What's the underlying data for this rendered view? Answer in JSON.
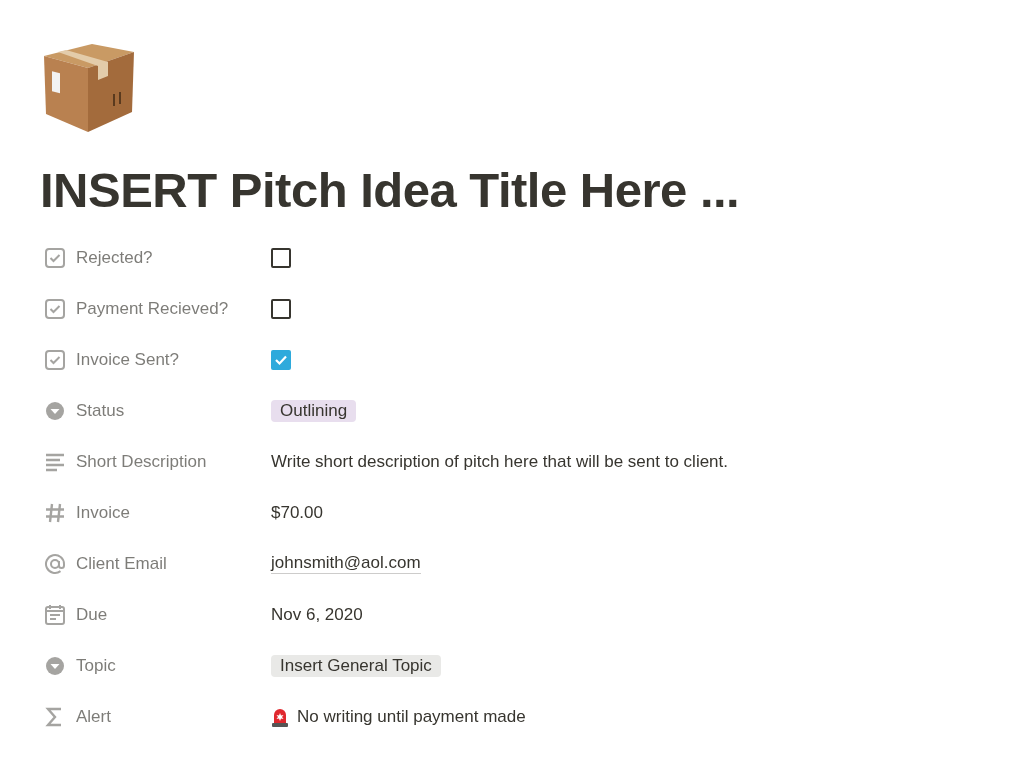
{
  "page": {
    "title": "INSERT Pitch Idea Title Here ..."
  },
  "properties": [
    {
      "kind": "checkbox",
      "label": "Rejected?",
      "checked": false
    },
    {
      "kind": "checkbox",
      "label": "Payment Recieved?",
      "checked": false
    },
    {
      "kind": "checkbox",
      "label": "Invoice Sent?",
      "checked": true
    },
    {
      "kind": "select",
      "label": "Status",
      "value": "Outlining",
      "color": "#e8deee"
    },
    {
      "kind": "text",
      "label": "Short Description",
      "value": "Write short description of pitch here that will be sent to client."
    },
    {
      "kind": "number",
      "label": "Invoice",
      "value": "$70.00"
    },
    {
      "kind": "email",
      "label": "Client Email",
      "value": "johnsmith@aol.com"
    },
    {
      "kind": "date",
      "label": "Due",
      "value": "Nov 6, 2020"
    },
    {
      "kind": "select",
      "label": "Topic",
      "value": "Insert General Topic",
      "color": "#e9e9e7"
    },
    {
      "kind": "formula",
      "label": "Alert",
      "value": "No writing until payment made"
    }
  ]
}
